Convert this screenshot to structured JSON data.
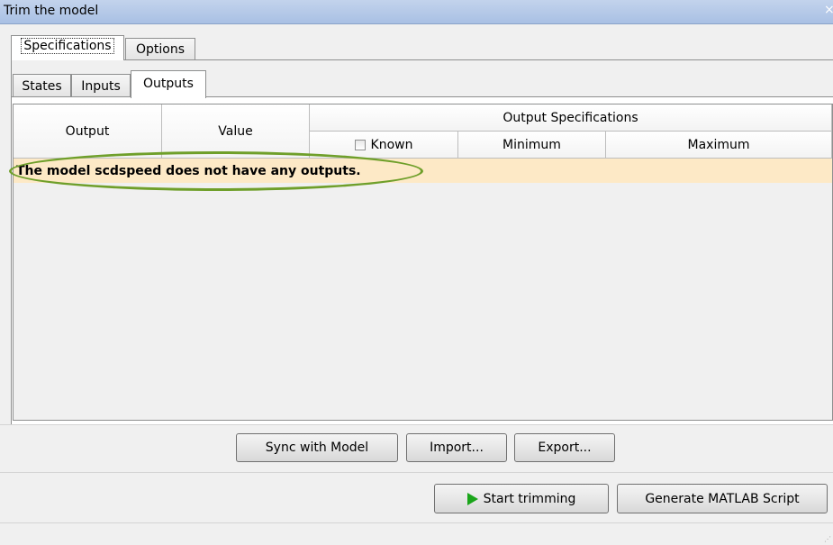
{
  "window": {
    "title": "Trim the model",
    "close_glyph": "×"
  },
  "outer_tabs": [
    {
      "label": "Specifications",
      "active": true
    },
    {
      "label": "Options",
      "active": false
    }
  ],
  "inner_tabs": [
    {
      "label": "States",
      "active": false
    },
    {
      "label": "Inputs",
      "active": false
    },
    {
      "label": "Outputs",
      "active": true
    }
  ],
  "table": {
    "col_output": "Output",
    "col_value": "Value",
    "group_header": "Output Specifications",
    "col_known": "Known",
    "col_minimum": "Minimum",
    "col_maximum": "Maximum",
    "known_checked": false,
    "message": "The model scdspeed does not have any outputs.",
    "message_bg": "#fde9c6"
  },
  "buttons": {
    "sync": "Sync with Model",
    "import": "Import...",
    "export": "Export...",
    "start": "Start trimming",
    "generate": "Generate MATLAB Script"
  },
  "colors": {
    "highlight": "#6f9f2a",
    "play": "#1aa51a"
  }
}
